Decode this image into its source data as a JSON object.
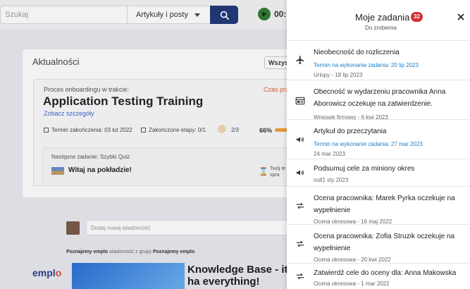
{
  "search": {
    "placeholder": "Szukaj",
    "category": "Artykuły i posty"
  },
  "timer": "00:0",
  "feed": {
    "title": "Aktualności",
    "filter_label": "Wszys",
    "onboarding_label": "Proces onboardingu w trakcie:",
    "onboarding_status": "Czas prz",
    "onboarding_title": "Application Testing Training",
    "details_link": "Zobacz szczegóły",
    "deadline": "Termin zakończenia: 03 lut 2022",
    "stages": "Zakończone etapy: 0/1",
    "score": "2/3",
    "progress_percent": "66%",
    "progress_value": 66,
    "next_task_label": "Następne zadanie: Szybki Quiz",
    "next_task_title": "Witaj na pokładzie!",
    "next_task_right": "Twój te na spra",
    "message_placeholder": "Dodaj nową wiadomość",
    "post_author": "Poznajemy emplo",
    "post_mid": "wiadomość z grupy",
    "post_group": "Poznajemy emplo",
    "post_logo_a": "empl",
    "post_logo_b": "o",
    "post_title": "Knowledge Base - it ha everything!"
  },
  "drawer": {
    "title": "Moje zadania",
    "badge": "32",
    "subtitle": "Do zrobienia",
    "tasks": [
      {
        "icon": "airplane-icon",
        "title": "Nieobecność do rozliczenia",
        "deadline": "Termin na wykonanie zadania: 20 lip 2023",
        "meta": "Urlopy - 18 lip 2023"
      },
      {
        "icon": "form-icon",
        "title": "Obecność w wydarzeniu pracownika Anna Aborowicz oczekuje na zatwierdzenie.",
        "deadline": "",
        "meta": "Wniosek firmowy - 6 kwi 2023"
      },
      {
        "icon": "megaphone-icon",
        "title": "Artykuł do przeczytania",
        "deadline": "Termin na wykonanie zadania: 27 mar 2023",
        "meta": "24 mar 2023"
      },
      {
        "icon": "megaphone-icon",
        "title": "Podsumuj cele za miniony okres",
        "deadline": "",
        "meta": "null1 sty 2023"
      },
      {
        "icon": "repeat-icon",
        "title": "Ocena pracownika: Marek Pyrka oczekuje na wypełnienie",
        "deadline": "",
        "meta": "Ocena okresowa - 16 maj 2022"
      },
      {
        "icon": "repeat-icon",
        "title": "Ocena pracownika: Zofia Struzik oczekuje na wypełnienie",
        "deadline": "",
        "meta": "Ocena okresowa - 20 kwi 2022"
      },
      {
        "icon": "repeat-icon",
        "title": "Zatwierdź cele do oceny dla: Anna Makowska",
        "deadline": "",
        "meta": "Ocena okresowa - 1 mar 2022"
      }
    ]
  }
}
